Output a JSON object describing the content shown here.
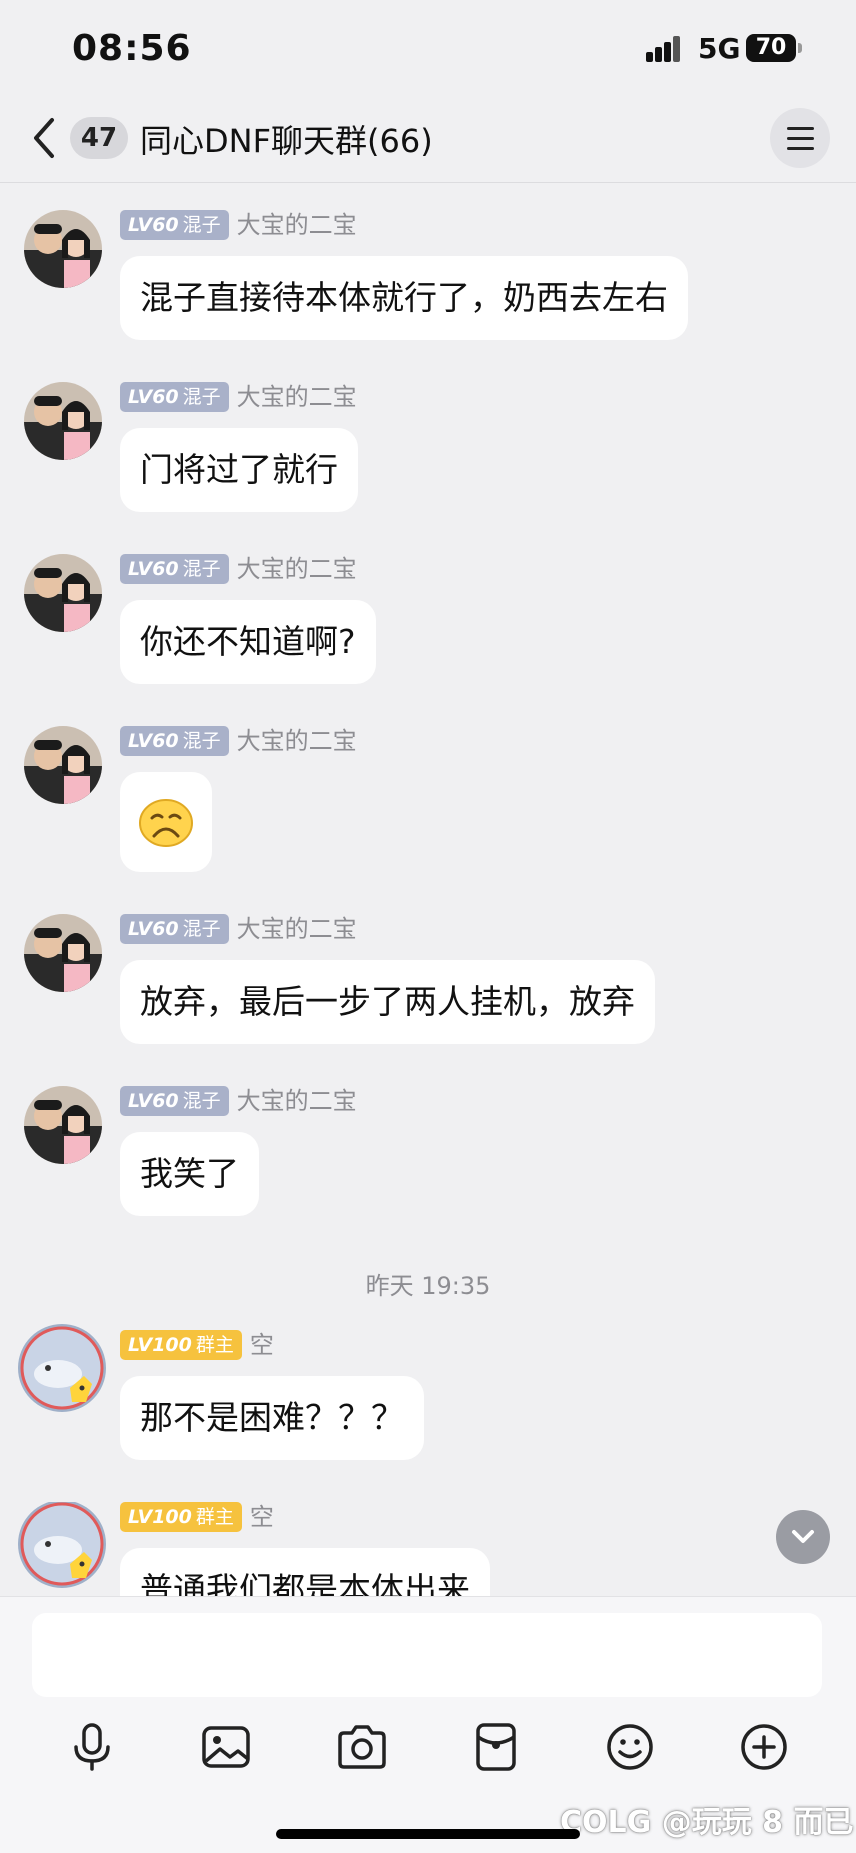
{
  "status_bar": {
    "time": "08:56",
    "network": "5G",
    "battery": "70"
  },
  "header": {
    "unread_count": "47",
    "title": "同心DNF聊天群(66)"
  },
  "messages": [
    {
      "level": "LV60",
      "role": "混子",
      "sender": "大宝的二宝",
      "text": "混子直接待本体就行了，奶西去左右"
    },
    {
      "level": "LV60",
      "role": "混子",
      "sender": "大宝的二宝",
      "text": "门将过了就行"
    },
    {
      "level": "LV60",
      "role": "混子",
      "sender": "大宝的二宝",
      "text": "你还不知道啊?"
    },
    {
      "level": "LV60",
      "role": "混子",
      "sender": "大宝的二宝",
      "emoji": "frowning-face-emoji"
    },
    {
      "level": "LV60",
      "role": "混子",
      "sender": "大宝的二宝",
      "text": "放弃，最后一步了两人挂机，放弃"
    },
    {
      "level": "LV60",
      "role": "混子",
      "sender": "大宝的二宝",
      "text": "我笑了"
    },
    {
      "level": "LV100",
      "role": "群主",
      "sender": "空",
      "text": "那不是困难？？？"
    },
    {
      "level": "LV100",
      "role": "群主",
      "sender": "空",
      "text": "普通我们都是本体出来"
    }
  ],
  "timestamp": "昨天 19:35",
  "toolbar": [
    "microphone-icon",
    "image-icon",
    "camera-icon",
    "red-packet-icon",
    "emoji-icon",
    "plus-icon"
  ],
  "watermark": "COLG @玩玩 8 而已",
  "colors": {
    "background": "#f0f0f2",
    "bubble": "#ffffff",
    "member_badge": "#a9b1c9",
    "owner_badge": "#f6c23e"
  }
}
